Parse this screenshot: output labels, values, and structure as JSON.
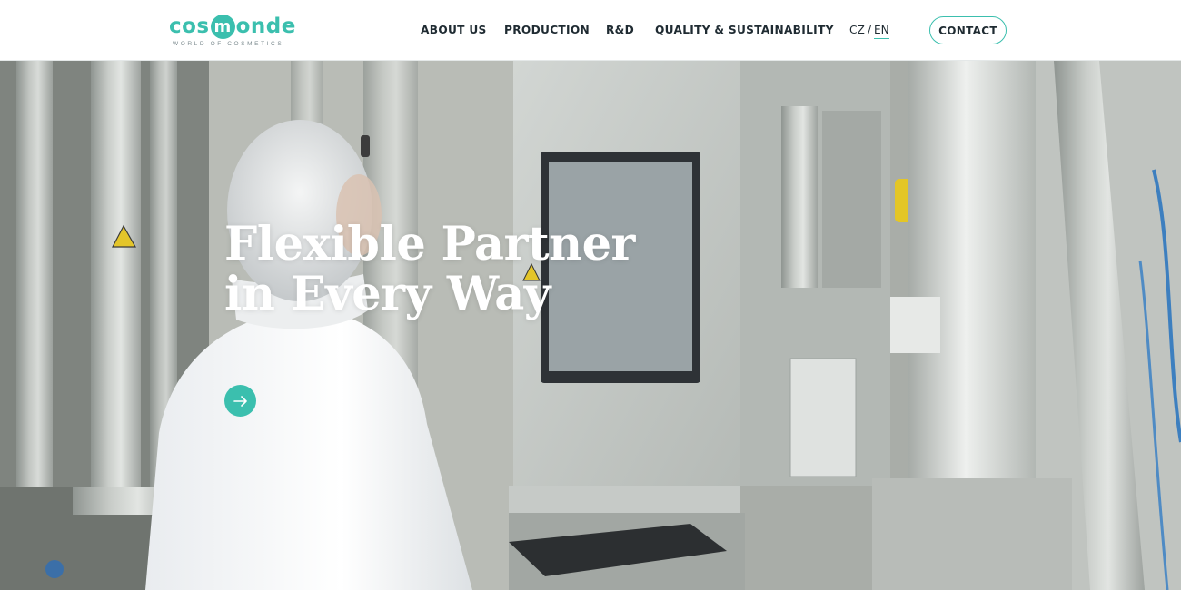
{
  "brand": {
    "logo_prefix": "cos",
    "logo_circle_letter": "m",
    "logo_suffix": "onde",
    "tagline": "WORLD OF COSMETICS",
    "accent_color": "#3bbfae",
    "text_color": "#1f2b32"
  },
  "nav": {
    "items": [
      {
        "label": "ABOUT US"
      },
      {
        "label": "PRODUCTION"
      },
      {
        "label": "R&D"
      },
      {
        "label": "QUALITY & SUSTAINABILITY"
      }
    ]
  },
  "language": {
    "options": [
      {
        "label": "CZ",
        "active": false
      },
      {
        "label": "EN",
        "active": true
      }
    ],
    "separator": "/"
  },
  "contact_button": {
    "label": "CONTACT"
  },
  "hero": {
    "title_line1": "Flexible Partner",
    "title_line2": "in Every Way",
    "arrow_icon": "arrow-right-icon",
    "background_image": "worker-in-hairnet-at-production-control-panel"
  }
}
